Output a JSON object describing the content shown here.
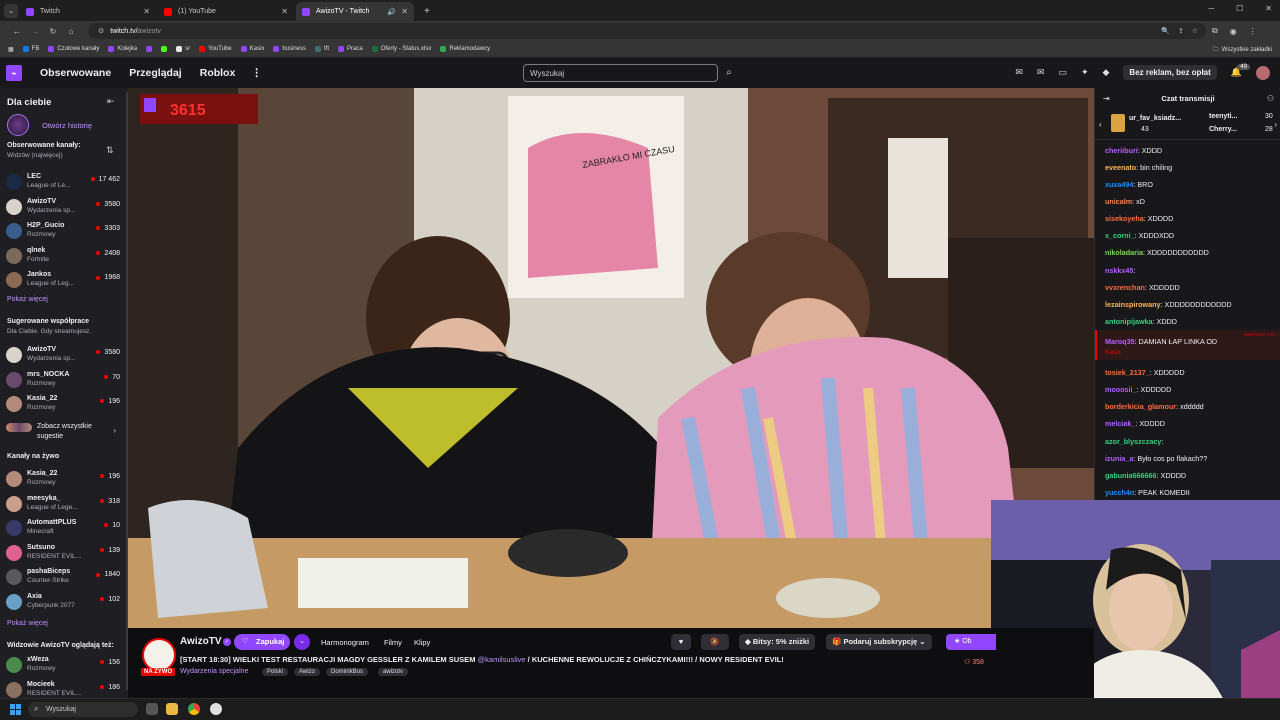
{
  "browser": {
    "tabs": [
      {
        "label": "Twitch",
        "color": "#9147ff"
      },
      {
        "label": "(1) YouTube",
        "color": "#ff0000"
      },
      {
        "label": "AwizoTV - Twitch",
        "color": "#9147ff"
      }
    ],
    "url_host": "twitch.tv/",
    "url_path": "awizotv",
    "bookmarks": [
      {
        "label": "FB",
        "color": "#1877f2"
      },
      {
        "label": "Czołowe kanały",
        "color": "#9147ff"
      },
      {
        "label": "Kolejka",
        "color": "#9147ff"
      },
      {
        "label": "",
        "color": "#9147ff"
      },
      {
        "label": "",
        "color": "#53fc18"
      },
      {
        "label": "sr",
        "color": "#e8e8e8"
      },
      {
        "label": "YouTube",
        "color": "#ff0000"
      },
      {
        "label": "Kasix",
        "color": "#9147ff"
      },
      {
        "label": "business",
        "color": "#9147ff"
      },
      {
        "label": "tft",
        "color": "#3c6e71"
      },
      {
        "label": "Praca",
        "color": "#9147ff"
      },
      {
        "label": "Oferty - Status.xlsx",
        "color": "#1d6f42"
      },
      {
        "label": "Reklamodawcy",
        "color": "#34a853"
      }
    ],
    "all_bookmarks": "Wszystkie zakładki"
  },
  "topnav": {
    "links": [
      "Obserwowane",
      "Przeglądaj",
      "Roblox"
    ],
    "more": "⋮",
    "search_placeholder": "Wyszukaj",
    "ad_free": "Bez reklam, bez opłat",
    "notif_count": "49"
  },
  "sidebar": {
    "title": "Dla ciebie",
    "history": "Otwórz historię",
    "followed_title": "Obserwowane kanały:",
    "followed_sort": "Widzów (najwięcej)",
    "followed": [
      {
        "name": "LEC",
        "cat": "League of Le...",
        "viewers": "17 462",
        "color": "#1a2a44"
      },
      {
        "name": "AwizoTV",
        "cat": "Wydarzenia sp...",
        "viewers": "3580",
        "color": "#d8d4cc"
      },
      {
        "name": "H2P_Gucio",
        "cat": "Rozmowy",
        "viewers": "3303",
        "color": "#3a5d8c"
      },
      {
        "name": "qlnek",
        "cat": "Fortnite",
        "viewers": "2408",
        "color": "#7a6a5a"
      },
      {
        "name": "Jankos",
        "cat": "League of Leg...",
        "viewers": "1968",
        "color": "#8a6a52"
      }
    ],
    "show_more": "Pokaż więcej",
    "suggested_title": "Sugerowane współprace",
    "suggested_sub": "Dla Ciebie. Gdy streamujesz.",
    "suggested": [
      {
        "name": "AwizoTV",
        "cat": "Wydarzenia sp...",
        "viewers": "3580",
        "color": "#d8d4cc"
      },
      {
        "name": "mrs_NOCKA",
        "cat": "Rozmowy",
        "viewers": "70",
        "color": "#6a4a6a"
      },
      {
        "name": "Kasia_22",
        "cat": "Rozmowy",
        "viewers": "196",
        "color": "#b48a7a"
      }
    ],
    "see_all_1": "Zobacz wszystkie",
    "see_all_2": "sugestie",
    "live_title": "Kanały na żywo",
    "live": [
      {
        "name": "Kasia_22",
        "cat": "Rozmowy",
        "viewers": "196",
        "color": "#b48a7a"
      },
      {
        "name": "meesyka_",
        "cat": "League of Lege...",
        "viewers": "318",
        "color": "#c9a08a"
      },
      {
        "name": "AutomattPLUS",
        "cat": "Minecraft",
        "viewers": "10",
        "color": "#3a3a6a"
      },
      {
        "name": "Sutsuno",
        "cat": "RESIDENT EVIL...",
        "viewers": "139",
        "color": "#e06090"
      },
      {
        "name": "pashaBiceps",
        "cat": "Counter-Strike",
        "viewers": "1840",
        "color": "#5a5a5a"
      },
      {
        "name": "Axia",
        "cat": "Cyberpunk 2077",
        "viewers": "102",
        "color": "#6aa0c8"
      }
    ],
    "show_more_2": "Pokaż więcej",
    "watching_title": "Widzowie AwizoTV oglądają też:",
    "watching": [
      {
        "name": "xWeza",
        "cat": "Rozmowy",
        "viewers": "156",
        "color": "#4a8a4a"
      },
      {
        "name": "Mocieek",
        "cat": "RESIDENT EVIL...",
        "viewers": "186",
        "color": "#8a7060"
      }
    ]
  },
  "video": {
    "overlay_count": "3615",
    "poster_text": "ZABRAKŁO MI CZASU"
  },
  "info": {
    "channel": "AwizoTV",
    "live": "NA ŻYWO",
    "follow": "Zapukaj",
    "links": [
      "Harmonogram",
      "Filmy",
      "Klipy"
    ],
    "bits": "Bitsy: 5% zniżki",
    "gift_sub": "Podaruj subskrypcję",
    "sub_short": "Ob",
    "title_main": "[START 18:30] WIELKI TEST RESTAURACJI MAGDY GESSLER Z KAMILEM SUSEM",
    "title_mention": "@kamilsuslive",
    "title_rest": "/ KUCHENNE REWOLUCJE Z CHIŃCZYKAMI!!! / NOWY RESIDENT EVIL!",
    "category": "Wydarzenia specjalne",
    "tags": [
      "Polski",
      "Awizo",
      "DominikBos",
      "awizotv"
    ],
    "viewers": "358"
  },
  "chat": {
    "title": "Czat transmisji",
    "gifters": [
      {
        "name": "ur_fav_ksiadz...",
        "count": "43"
      },
      {
        "name": "teenyti...",
        "count": "30"
      },
      {
        "name": "Cherry...",
        "count": "28"
      }
    ],
    "messages": [
      {
        "user": "cheriiburi",
        "color": "#b65eff",
        "text": ": XDDD"
      },
      {
        "user": "eveenato",
        "color": "#ffb454",
        "text": ": bin chiling"
      },
      {
        "user": "xuxa494",
        "color": "#1e90ff",
        "text": ": BRO"
      },
      {
        "user": "unicalm",
        "color": "#ff7f50",
        "text": ": xD"
      },
      {
        "user": "sisekoyeha",
        "color": "#ff6a3d",
        "text": ": XDDDD"
      },
      {
        "user": "x_corni_",
        "color": "#35d07f",
        "text": ": XDDDXDD"
      },
      {
        "user": "nikoladaria",
        "color": "#7cd958",
        "text": ": XDDDDDDDDDDD"
      },
      {
        "user": "nskkx45",
        "color": "#b65eff",
        "text": ":"
      },
      {
        "user": "vvxrenchan",
        "color": "#ff6a3d",
        "text": ": XDDDDD"
      },
      {
        "user": "lezainspirowany",
        "color": "#ffb454",
        "text": ": XDDDDDDDDDDDD"
      },
      {
        "user": "antonipijawka",
        "color": "#35d07f",
        "text": ": XDDD"
      },
      {
        "user": "Maroq35",
        "color": "#b65eff",
        "text": ": DAMIAN ŁAP LINKA OD"
      },
      {
        "user": "tosiek_2137_",
        "color": "#ff6a3d",
        "text": ": XDDDDD"
      },
      {
        "user": "mooosii_",
        "color": "#b65eff",
        "text": ": XDDDDD"
      },
      {
        "user": "borderkicia_glamour",
        "color": "#ff6a3d",
        "text": ": xddddd"
      },
      {
        "user": "melciak_",
        "color": "#b65eff",
        "text": ": XDDDD"
      },
      {
        "user": "azor_blyszczacy",
        "color": "#35d07f",
        "text": ":"
      },
      {
        "user": "izunia_a",
        "color": "#b65eff",
        "text": ": Było cos po flakach??"
      },
      {
        "user": "gabunia666666",
        "color": "#35d07f",
        "text": ": XDDDD"
      },
      {
        "user": "yucch4n",
        "color": "#1e90ff",
        "text": ": PEAK KOMEDII"
      }
    ],
    "highlight_sub": "Kasix",
    "highlight_tag": "MENTIONS YOU"
  },
  "taskbar": {
    "search": "Wyszukaj"
  }
}
